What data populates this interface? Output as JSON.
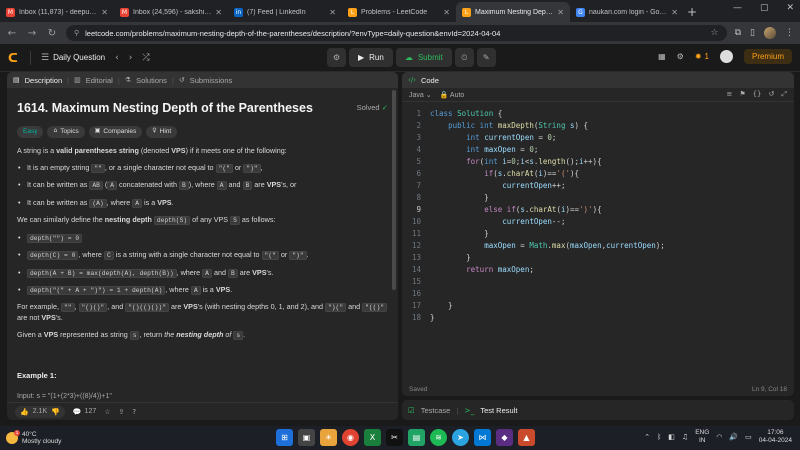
{
  "browser": {
    "tabs": [
      {
        "title": "Inbox (11,873) - deepu.m@",
        "fav": "M",
        "favColor": "#ea4335",
        "active": false
      },
      {
        "title": "Inbox (24,596) - sakshi.e@",
        "fav": "M",
        "favColor": "#ea4335",
        "active": false
      },
      {
        "title": "(7) Feed | LinkedIn",
        "fav": "in",
        "favColor": "#0a66c2",
        "active": false
      },
      {
        "title": "Problems - LeetCode",
        "fav": "L",
        "favColor": "#ffa116",
        "active": false
      },
      {
        "title": "Maximum Nesting Depth o",
        "fav": "L",
        "favColor": "#ffa116",
        "active": true
      },
      {
        "title": "naukari.com login - Googl",
        "fav": "G",
        "favColor": "#4285f4",
        "active": false
      }
    ],
    "new_tab": "+",
    "window_controls": [
      "—",
      "▢",
      "✕"
    ],
    "url": "leetcode.com/problems/maximum-nesting-depth-of-the-parentheses/description/?envType=daily-question&envId=2024-04-04"
  },
  "header": {
    "title": "Daily Question",
    "run_label": "Run",
    "submit_label": "Submit",
    "streak_count": "1",
    "premium_label": "Premium"
  },
  "left_tabs": {
    "description": "Description",
    "editorial": "Editorial",
    "solutions": "Solutions",
    "submissions": "Submissions"
  },
  "problem": {
    "title": "1614. Maximum Nesting Depth of the Parentheses",
    "status": "Solved",
    "chips": [
      "Easy",
      "Topics",
      "Companies",
      "Hint"
    ],
    "intro_a": "A string is a ",
    "intro_b": "valid parentheses string",
    "intro_c": " (denoted ",
    "intro_d": "VPS",
    "intro_e": ") if it meets one of the following:",
    "b1_a": "It is an empty string ",
    "b1_c1": "\"\"",
    "b1_b": ", or a single character not equal to ",
    "b1_c2": "\"(\"",
    "b1_or": " or ",
    "b1_c3": "\")\"",
    "b1_end": ",",
    "b2_a": "It can be written as ",
    "b2_c1": "AB",
    "b2_b": " (",
    "b2_c2": "A",
    "b2_c": " concatenated with ",
    "b2_c3": "B",
    "b2_d": "), where ",
    "b2_c4": "A",
    "b2_and": " and ",
    "b2_c5": "B",
    "b2_e": " are ",
    "b2_vps": "VPS",
    "b2_f": "'s, or",
    "b3_a": "It can be written as ",
    "b3_c1": "(A)",
    "b3_b": ", where ",
    "b3_c2": "A",
    "b3_c": " is a ",
    "b3_vps": "VPS",
    "b3_d": ".",
    "p2_a": "We can similarly define the ",
    "p2_b": "nesting depth",
    "p2_c1": "depth(S)",
    "p2_d": " of any VPS ",
    "p2_c2": "S",
    "p2_e": " as follows:",
    "d1": "depth(\"\") = 0",
    "d2_c": "depth(C) = 0",
    "d2_a": ", where ",
    "d2_c2": "C",
    "d2_b": " is a string with a single character not equal to ",
    "d2_c3": "\"(\"",
    "d2_or": " or ",
    "d2_c4": "\")\"",
    "d2_end": ".",
    "d3_c": "depth(A + B) = max(depth(A), depth(B))",
    "d3_a": ", where ",
    "d3_c2": "A",
    "d3_and": " and ",
    "d3_c3": "B",
    "d3_b": " are ",
    "d3_vps": "VPS",
    "d3_end": "'s.",
    "d4_c": "depth(\"(\" + A + \")\") = 1 + depth(A)",
    "d4_a": ", where ",
    "d4_c2": "A",
    "d4_b": " is a ",
    "d4_vps": "VPS",
    "d4_end": ".",
    "p3_a": "For example, ",
    "p3_c1": "\"\"",
    "p3_c2": "\"()()\"",
    "p3_and": ", and ",
    "p3_c3": "\"()(()())\"",
    "p3_b": " are ",
    "p3_vps": "VPS",
    "p3_c": "'s (with nesting depths 0, 1, and 2), and ",
    "p3_c4": "\")(\"",
    "p3_d": " and ",
    "p3_c5": "\"(()\"",
    "p3_e": " are not ",
    "p3_vps2": "VPS",
    "p3_f": "'s.",
    "p4_a": "Given a ",
    "p4_vps": "VPS",
    "p4_b": " represented as string ",
    "p4_c1": "s",
    "p4_c": ", return ",
    "p4_d": "the ",
    "p4_e": "nesting depth",
    "p4_f": " of ",
    "p4_c2": "s",
    "p4_g": ".",
    "example_title": "Example 1:",
    "example_input": "Input: s = \"(1+(2*3)+((8)/4))+1\""
  },
  "desc_footer": {
    "likes": "2.1K",
    "comments": "127"
  },
  "code_panel": {
    "title": "Code",
    "language": "Java",
    "auto": "Auto",
    "saved": "Saved",
    "cursor": "Ln 9, Col 18"
  },
  "code_lines": [
    {
      "n": "1"
    },
    {
      "n": "2"
    },
    {
      "n": "3"
    },
    {
      "n": "4"
    },
    {
      "n": "5"
    },
    {
      "n": "6"
    },
    {
      "n": "7"
    },
    {
      "n": "8"
    },
    {
      "n": "9"
    },
    {
      "n": "10"
    },
    {
      "n": "11"
    },
    {
      "n": "12"
    },
    {
      "n": "13"
    },
    {
      "n": "14"
    },
    {
      "n": "15"
    },
    {
      "n": "16"
    },
    {
      "n": "17"
    },
    {
      "n": "18"
    }
  ],
  "bottom_tabs": {
    "testcase": "Testcase",
    "result": "Test Result"
  },
  "taskbar": {
    "temp": "40°C",
    "weather": "Mostly cloudy",
    "lang_top": "ENG",
    "lang_bottom": "IN",
    "time": "17:06",
    "date": "04-04-2024"
  }
}
